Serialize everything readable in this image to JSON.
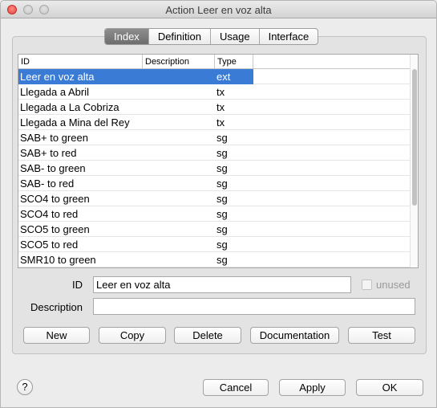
{
  "window": {
    "title": "Action Leer en voz alta"
  },
  "tabs": [
    "Index",
    "Definition",
    "Usage",
    "Interface"
  ],
  "table": {
    "headers": {
      "id": "ID",
      "description": "Description",
      "type": "Type"
    },
    "rows": [
      {
        "id": "Leer en voz alta",
        "type": "ext"
      },
      {
        "id": "Llegada a Abril",
        "type": "tx"
      },
      {
        "id": "Llegada a La Cobriza",
        "type": "tx"
      },
      {
        "id": "Llegada a Mina del Rey",
        "type": "tx"
      },
      {
        "id": "SAB+ to green",
        "type": "sg"
      },
      {
        "id": "SAB+ to red",
        "type": "sg"
      },
      {
        "id": "SAB- to green",
        "type": "sg"
      },
      {
        "id": "SAB- to red",
        "type": "sg"
      },
      {
        "id": "SCO4 to green",
        "type": "sg"
      },
      {
        "id": "SCO4 to red",
        "type": "sg"
      },
      {
        "id": "SCO5 to green",
        "type": "sg"
      },
      {
        "id": "SCO5 to red",
        "type": "sg"
      },
      {
        "id": "SMR10 to green",
        "type": "sg"
      }
    ]
  },
  "form": {
    "id_label": "ID",
    "id_value": "Leer en voz alta",
    "unused_label": "unused",
    "description_label": "Description",
    "description_value": ""
  },
  "actions": {
    "new": "New",
    "copy": "Copy",
    "delete": "Delete",
    "documentation": "Documentation",
    "test": "Test"
  },
  "footer": {
    "help": "?",
    "cancel": "Cancel",
    "apply": "Apply",
    "ok": "OK"
  },
  "colors": {
    "selection": "#3a7bd5",
    "active_tab": "#7a7a7a"
  }
}
